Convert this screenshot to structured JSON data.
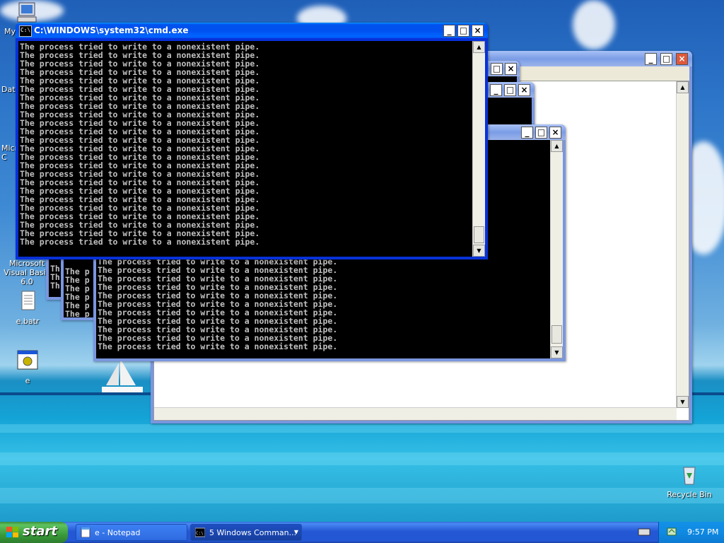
{
  "desktop": {
    "icons": [
      {
        "label": "My",
        "icon": "my-computer-icon"
      },
      {
        "label": "Dat",
        "icon": "data-icon"
      },
      {
        "label": "Micro\nC",
        "icon": "microsoft-icon"
      },
      {
        "label": "Microsoft Visual Basic 6.0",
        "icon": "visual-basic-icon"
      },
      {
        "label": "e.batr",
        "icon": "text-file-icon"
      },
      {
        "label": "e",
        "icon": "application-icon"
      },
      {
        "label": "Recycle Bin",
        "icon": "recycle-bin-icon"
      }
    ]
  },
  "cmd_main": {
    "title": "C:\\WINDOWS\\system32\\cmd.exe",
    "line": "The process tried to write to a nonexistent pipe.",
    "line_count": 24
  },
  "cmd_back": {
    "line": "The process tried to write to a nonexistent pipe.",
    "line_count": 11
  },
  "cmd_back_small": {
    "line_prefix": "The p",
    "line_count": 6
  },
  "cmd_back_tiny": {
    "line_prefix": "Th",
    "line_count": 3
  },
  "taskbar": {
    "start_label": "start",
    "tasks": [
      {
        "label": "e - Notepad",
        "icon": "notepad-icon"
      },
      {
        "label": "5 Windows Comman...",
        "icon": "cmd-icon"
      }
    ],
    "clock": "9:57 PM"
  },
  "colors": {
    "titlebar_active": "#0054e3",
    "console_bg": "#000000",
    "console_fg": "#c0c0c0",
    "taskbar": "#245edb",
    "start_green": "#3c9f3c"
  }
}
